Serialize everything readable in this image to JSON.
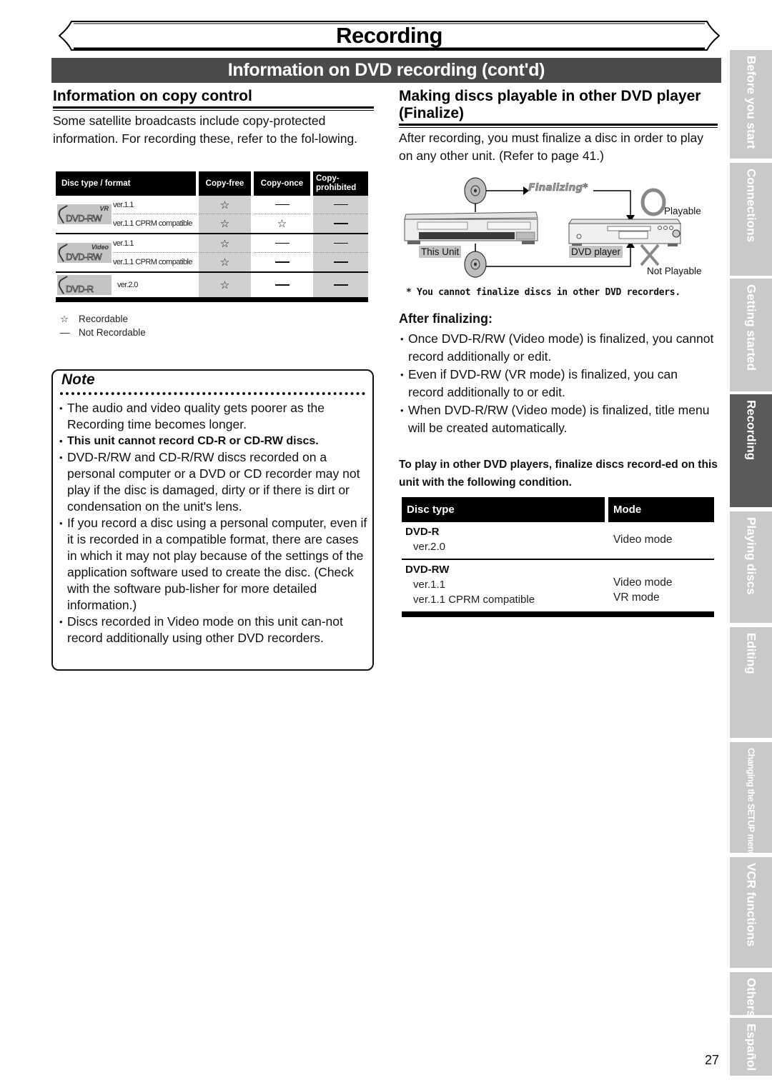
{
  "banner": {
    "title": "Recording"
  },
  "section_title": "Information on DVD recording (cont'd)",
  "left": {
    "heading": "Information on copy control",
    "intro": "Some satellite broadcasts include copy-protected information. For recording these, refer to the fol-lowing.",
    "copy_table": {
      "headers": [
        "Disc type / format",
        "Copy-free",
        "Copy-once",
        "Copy-prohibited"
      ],
      "groups": [
        {
          "logo": {
            "top": "VR",
            "main": "DVD-RW"
          },
          "rows": [
            {
              "version": "ver.1.1",
              "copy_free": "recordable",
              "copy_once": "not-recordable",
              "copy_prohibited": "not-recordable"
            },
            {
              "version": "ver.1.1 CPRM compatible",
              "copy_free": "recordable",
              "copy_once": "recordable",
              "copy_prohibited": "not-recordable"
            }
          ]
        },
        {
          "logo": {
            "top": "Video",
            "main": "DVD-RW"
          },
          "rows": [
            {
              "version": "ver.1.1",
              "copy_free": "recordable",
              "copy_once": "not-recordable",
              "copy_prohibited": "not-recordable"
            },
            {
              "version": "ver.1.1 CPRM compatible",
              "copy_free": "recordable",
              "copy_once": "not-recordable",
              "copy_prohibited": "not-recordable"
            }
          ]
        },
        {
          "logo": {
            "top": "",
            "main": "DVD-R"
          },
          "rows": [
            {
              "version": "ver.2.0",
              "copy_free": "recordable",
              "copy_once": "not-recordable",
              "copy_prohibited": "not-recordable"
            }
          ]
        }
      ],
      "symbols": {
        "recordable": "☆",
        "not-recordable": "—"
      }
    },
    "legend": [
      {
        "symbol": "☆",
        "label": "Recordable"
      },
      {
        "symbol": "—",
        "label": "Not Recordable"
      }
    ],
    "note": {
      "title": "Note",
      "items": [
        {
          "text": "The audio and video quality gets poorer as the Recording time becomes longer.",
          "bold": false
        },
        {
          "text": "This unit cannot record CD-R or CD-RW discs.",
          "bold": true
        },
        {
          "text": "DVD-R/RW and CD-R/RW discs recorded on a personal computer or a DVD or CD recorder may not play if the disc is damaged, dirty or if there is dirt or condensation on the unit's lens.",
          "bold": false
        },
        {
          "text": "If you record a disc using a personal computer, even if it is recorded in a compatible format, there are cases in which it may not play because of the settings of the application software used to create the disc. (Check with the software pub-lisher for more detailed information.)",
          "bold": false
        },
        {
          "text": "Discs recorded in Video mode on this unit can-not record additionally using other DVD recorders.",
          "bold": false
        }
      ]
    }
  },
  "right": {
    "heading": "Making discs playable in other DVD player (Finalize)",
    "intro": "After recording, you must finalize a disc in order to play on any other unit. (Refer to page 41.)",
    "diagram": {
      "finalizing_label": "Finalizing*",
      "this_unit_label": "This Unit",
      "dvd_player_label": "DVD player",
      "playable_label": "Playable",
      "not_playable_label": "Not Playable"
    },
    "footnote": "* You cannot finalize discs in other DVD recorders.",
    "after_heading": "After finalizing:",
    "after_items": [
      "Once DVD-R/RW (Video mode) is finalized, you cannot record additionally or edit.",
      "Even if DVD-RW (VR mode) is finalized, you can record additionally to or edit.",
      "When DVD-R/RW (Video mode) is finalized, title menu will be created automatically."
    ],
    "condition": "To play in other DVD players, finalize discs record-ed on this unit with the following condition.",
    "mode_table": {
      "headers": [
        "Disc type",
        "Mode"
      ],
      "rows": [
        {
          "type": "DVD-R",
          "versions": [
            "ver.2.0"
          ],
          "modes": [
            "Video mode"
          ]
        },
        {
          "type": "DVD-RW",
          "versions": [
            "ver.1.1",
            "ver.1.1 CPRM compatible"
          ],
          "modes": [
            "Video mode",
            "VR mode"
          ]
        }
      ]
    }
  },
  "side_tabs": [
    {
      "label": "Before you start",
      "active": false
    },
    {
      "label": "Connections",
      "active": false
    },
    {
      "label": "Getting started",
      "active": false
    },
    {
      "label": "Recording",
      "active": true
    },
    {
      "label": "Playing discs",
      "active": false
    },
    {
      "label": "Editing",
      "active": false
    },
    {
      "label": "Changing the SETUP menu",
      "active": false
    },
    {
      "label": "VCR functions",
      "active": false
    },
    {
      "label": "Others",
      "active": false
    },
    {
      "label": "Español",
      "active": false
    }
  ],
  "page_number": "27"
}
